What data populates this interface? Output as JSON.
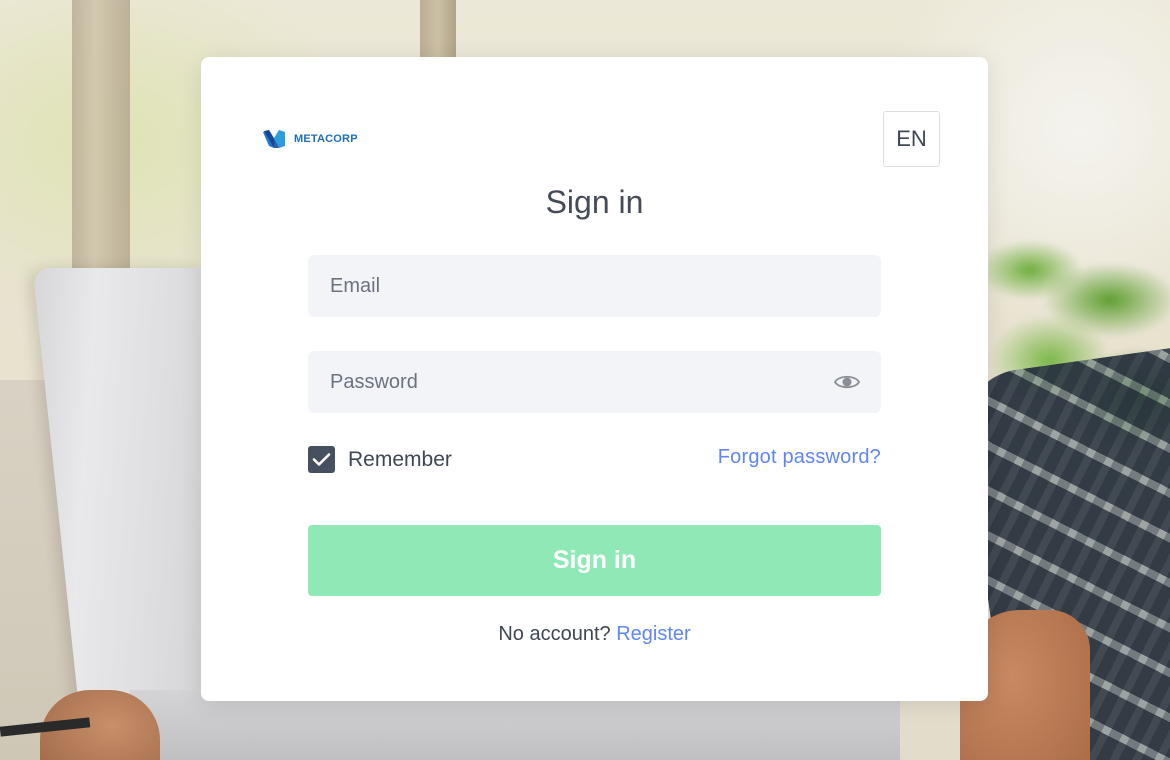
{
  "logo": {
    "text": "METACORP",
    "icon": "metacorp-logo-icon"
  },
  "language": {
    "label": "EN"
  },
  "form": {
    "title": "Sign in",
    "email": {
      "placeholder": "Email",
      "value": ""
    },
    "password": {
      "placeholder": "Password",
      "value": "",
      "toggle_icon": "eye-icon"
    },
    "remember": {
      "label": "Remember",
      "checked": true
    },
    "forgot_label": "Forgot password?",
    "submit_label": "Sign in",
    "no_account_text": "No account?",
    "register_label": "Register"
  },
  "colors": {
    "primary_button": "#8fe9b6",
    "link": "#5f86f2",
    "checkbox": "#46505f",
    "field_bg": "#f3f4f7",
    "text": "#454c58"
  }
}
